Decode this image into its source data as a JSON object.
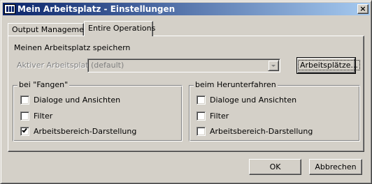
{
  "window": {
    "title": "Mein Arbeitsplatz - Einstellungen",
    "close_glyph": "×"
  },
  "tabs": [
    {
      "label": "Output Management",
      "active": false
    },
    {
      "label": "Entire Operations",
      "active": true
    }
  ],
  "section": {
    "heading": "Meinen Arbeitsplatz speichern",
    "active_label": "Aktiver Arbeitsplatz:",
    "active_value": "(default)",
    "workspaces_button": "Arbeitsplätze..."
  },
  "groups": [
    {
      "title": "bei \"Fangen\"",
      "options": [
        {
          "label": "Dialoge und Ansichten",
          "checked": false
        },
        {
          "label": "Filter",
          "checked": false
        },
        {
          "label": "Arbeitsbereich-Darstellung",
          "checked": true
        }
      ]
    },
    {
      "title": "beim Herunterfahren",
      "options": [
        {
          "label": "Dialoge und Ansichten",
          "checked": false
        },
        {
          "label": "Filter",
          "checked": false
        },
        {
          "label": "Arbeitsbereich-Darstellung",
          "checked": false
        }
      ]
    }
  ],
  "footer": {
    "ok_label": "OK",
    "cancel_label": "Abbrechen"
  }
}
